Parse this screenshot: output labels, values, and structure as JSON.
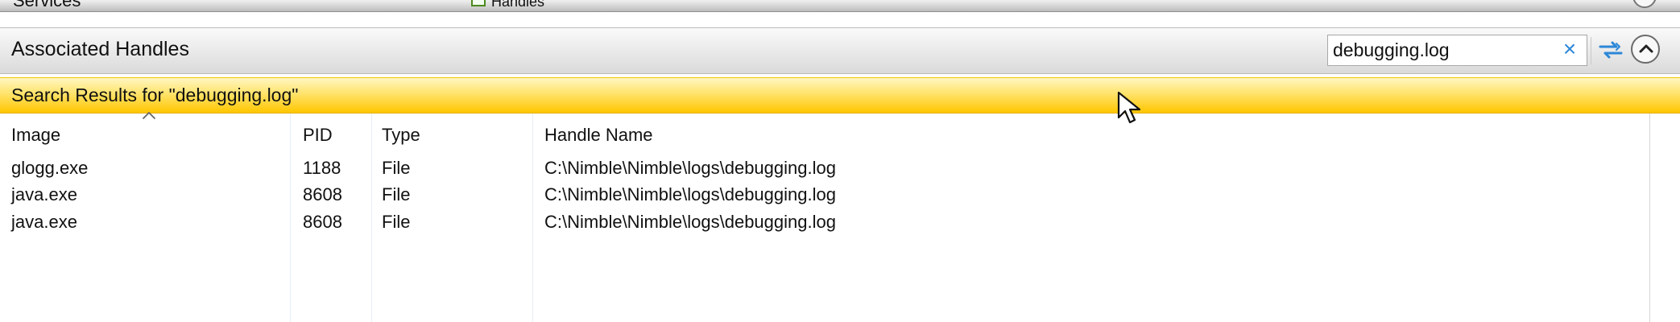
{
  "top_panel": {
    "partial_label": "Services",
    "partial_tab": "Handles"
  },
  "associated_handles": {
    "title": "Associated Handles",
    "search": {
      "value": "debugging.log",
      "placeholder": ""
    },
    "clear_label": "×",
    "results_text": "Search Results for \"debugging.log\""
  },
  "table": {
    "columns": [
      "Image",
      "PID",
      "Type",
      "Handle Name"
    ],
    "rows": [
      [
        "glogg.exe",
        "1188",
        "File",
        "C:\\Nimble\\Nimble\\logs\\debugging.log"
      ],
      [
        "java.exe",
        "8608",
        "File",
        "C:\\Nimble\\Nimble\\logs\\debugging.log"
      ],
      [
        "java.exe",
        "8608",
        "File",
        "C:\\Nimble\\Nimble\\logs\\debugging.log"
      ]
    ]
  },
  "icons": {
    "search_clear": "close-icon",
    "refresh": "refresh-icon",
    "collapse": "chevron-up-icon",
    "sort": "sort-up-icon",
    "cursor": "mouse-cursor-icon"
  },
  "colors": {
    "accent": "#2c87d8",
    "results_bar": "#ffc600",
    "panel_header": "#dadada"
  }
}
